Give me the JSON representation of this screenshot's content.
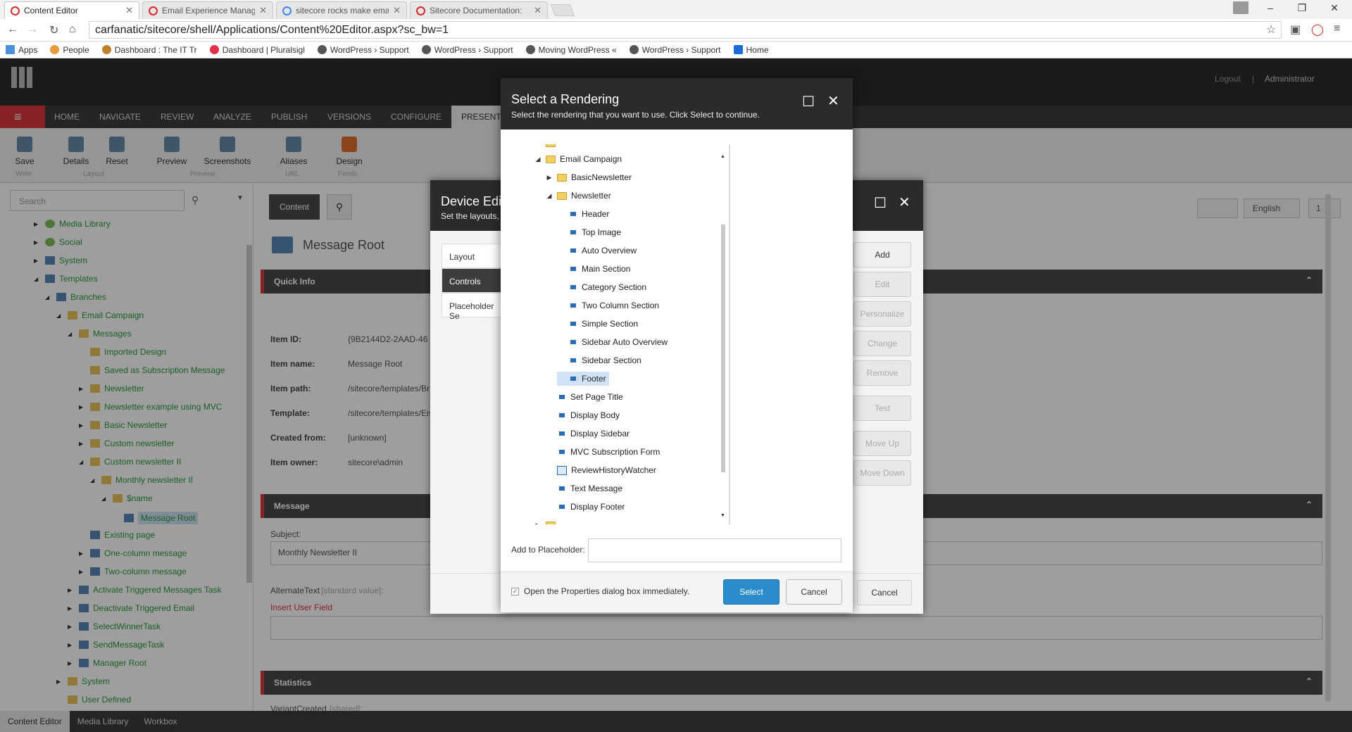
{
  "browser": {
    "tabs": [
      {
        "title": "Content Editor",
        "active": true
      },
      {
        "title": "Email Experience Manage",
        "active": false
      },
      {
        "title": "sitecore rocks make ema",
        "active": false
      },
      {
        "title": "Sitecore Documentation:",
        "active": false
      }
    ],
    "url": "carfanatic/sitecore/shell/Applications/Content%20Editor.aspx?sc_bw=1",
    "bookmarks": [
      "Apps",
      "People",
      "Dashboard : The IT Tr",
      "Dashboard | Pluralsigl",
      "WordPress › Support",
      "WordPress › Support",
      "Moving WordPress «",
      "WordPress › Support",
      "Home"
    ]
  },
  "app": {
    "header": {
      "logout": "Logout",
      "separator": "|",
      "user": "Administrator"
    },
    "ribbon_tabs": [
      "HOME",
      "NAVIGATE",
      "REVIEW",
      "ANALYZE",
      "PUBLISH",
      "VERSIONS",
      "CONFIGURE",
      "PRESENT"
    ],
    "ribbon_buttons": [
      "Save",
      "Details",
      "Reset",
      "Preview",
      "Screenshots",
      "Aliases",
      "Design"
    ],
    "ribbon_groups": [
      "Write",
      "Layout",
      "Preview",
      "URL",
      "Feeds"
    ],
    "search_placeholder": "Search",
    "tree": [
      {
        "label": "Media Library"
      },
      {
        "label": "Social"
      },
      {
        "label": "System"
      },
      {
        "label": "Templates"
      },
      {
        "label": "Branches"
      },
      {
        "label": "Email Campaign"
      },
      {
        "label": "Messages"
      },
      {
        "label": "Imported Design"
      },
      {
        "label": "Saved as Subscription Message"
      },
      {
        "label": "Newsletter"
      },
      {
        "label": "Newsletter example using MVC"
      },
      {
        "label": "Basic Newsletter"
      },
      {
        "label": "Custom newsletter"
      },
      {
        "label": "Custom newsletter II"
      },
      {
        "label": "Monthly newsletter II"
      },
      {
        "label": "$name"
      },
      {
        "label": "Message Root"
      },
      {
        "label": "Existing page"
      },
      {
        "label": "One-column message"
      },
      {
        "label": "Two-column message"
      },
      {
        "label": "Activate Triggered Messages Task"
      },
      {
        "label": "Deactivate Triggered Email"
      },
      {
        "label": "SelectWinnerTask"
      },
      {
        "label": "SendMessageTask"
      },
      {
        "label": "Manager Root"
      },
      {
        "label": "System"
      },
      {
        "label": "User Defined"
      }
    ],
    "content_tab": "Content",
    "lang": "English",
    "version": "1",
    "item_title": "Message Root",
    "sections": {
      "quick_info": "Quick Info",
      "message": "Message",
      "statistics": "Statistics"
    },
    "fields": [
      {
        "label": "Item ID:",
        "value": "{9B2144D2-2AAD-46"
      },
      {
        "label": "Item name:",
        "value": "Message Root"
      },
      {
        "label": "Item path:",
        "value": "/sitecore/templates/Br"
      },
      {
        "label": "Template:",
        "value": "/sitecore/templates/Em"
      },
      {
        "label": "Created from:",
        "value": "[unknown]"
      },
      {
        "label": "Item owner:",
        "value": "sitecore\\admin"
      }
    ],
    "subject_label": "Subject:",
    "subject_value": "Monthly Newsletter II",
    "alt_text_label": "AlternateText",
    "alt_text_hint": "[standard value]:",
    "insert_user_field": "Insert User Field",
    "variant_label": "VariantCreated",
    "variant_hint": "[shared]:",
    "bottom_tabs": [
      "Content Editor",
      "Media Library",
      "Workbox"
    ]
  },
  "device_editor": {
    "title": "Device Edi",
    "subtitle": "Set the layouts,",
    "side_items": [
      "Layout",
      "Controls",
      "Placeholder Se"
    ],
    "buttons": [
      "Add",
      "Edit",
      "Personalize",
      "Change",
      "Remove",
      "Test",
      "Move Up",
      "Move Down"
    ],
    "cancel": "Cancel"
  },
  "select_rendering": {
    "title": "Select a Rendering",
    "subtitle": "Select the rendering that you want to use. Click Select to continue.",
    "tree": [
      {
        "label": "Email Campaign"
      },
      {
        "label": "BasicNewsletter"
      },
      {
        "label": "Newsletter"
      },
      {
        "label": "Header"
      },
      {
        "label": "Top Image"
      },
      {
        "label": "Auto Overview"
      },
      {
        "label": "Main Section"
      },
      {
        "label": "Category Section"
      },
      {
        "label": "Two Column Section"
      },
      {
        "label": "Simple Section"
      },
      {
        "label": "Sidebar Auto Overview"
      },
      {
        "label": "Sidebar Section"
      },
      {
        "label": "Footer"
      },
      {
        "label": "Set Page Title"
      },
      {
        "label": "Display Body"
      },
      {
        "label": "Display Sidebar"
      },
      {
        "label": "MVC Subscription Form"
      },
      {
        "label": "ReviewHistoryWatcher"
      },
      {
        "label": "Text Message"
      },
      {
        "label": "Display Footer"
      }
    ],
    "placeholder_label": "Add to Placeholder:",
    "placeholder_value": "",
    "checkbox_label": "Open the Properties dialog box immediately.",
    "checkbox_mark": "✓",
    "select": "Select",
    "cancel": "Cancel"
  }
}
